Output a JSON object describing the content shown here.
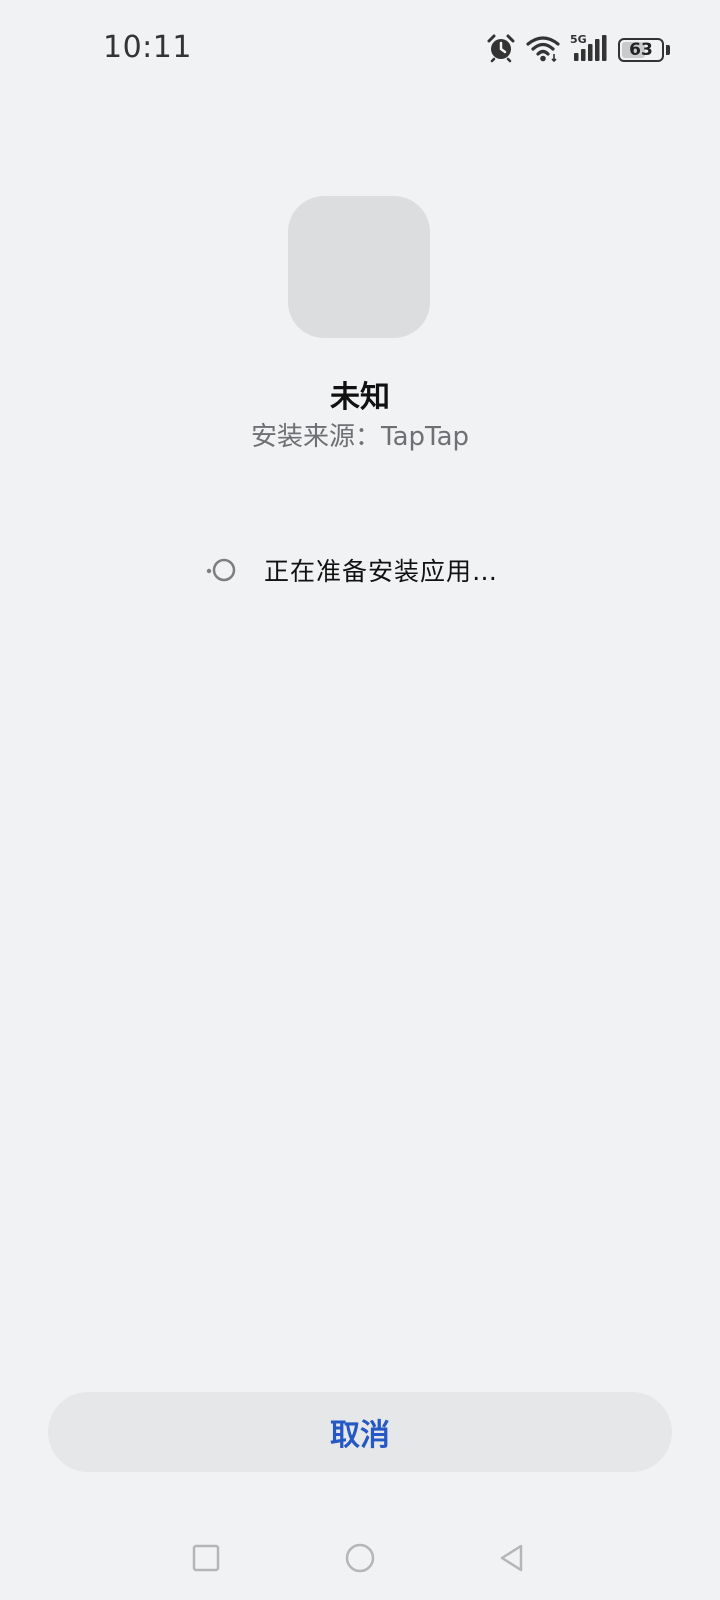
{
  "status_bar": {
    "time": "10:11",
    "icons": [
      "alarm-icon",
      "wifi-icon",
      "5g-signal-icon",
      "battery-icon"
    ],
    "network_label": "5G",
    "battery_level": "63",
    "battery_fraction": 0.63
  },
  "app": {
    "name": "未知",
    "install_source": "安装来源：TapTap"
  },
  "progress": {
    "text": "正在准备安装应用…"
  },
  "actions": {
    "cancel_label": "取消"
  },
  "nav_bar": {
    "buttons": [
      "recents-square-icon",
      "home-circle-icon",
      "back-triangle-icon"
    ]
  },
  "colors": {
    "background": "#f1f2f4",
    "accent": "#2458c5",
    "icon_placeholder": "#dcdddf",
    "button_bg": "#e6e7e9"
  }
}
